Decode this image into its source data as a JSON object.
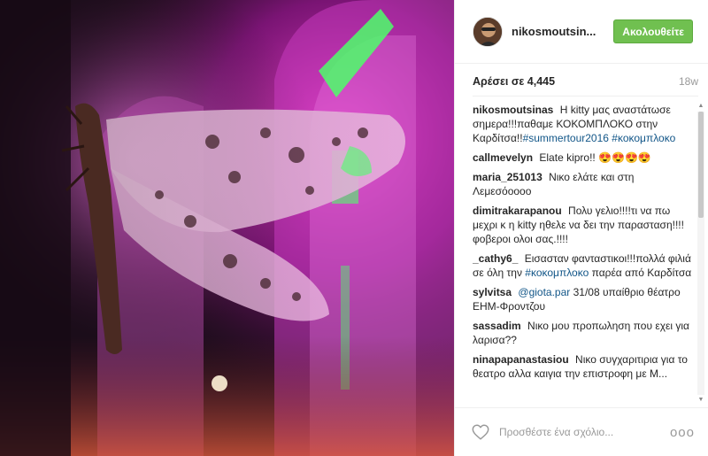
{
  "header": {
    "username": "nikosmoutsin...",
    "follow_label": "Ακολουθείτε"
  },
  "stats": {
    "likes": "Αρέσει σε 4,445",
    "time": "18w"
  },
  "caption": {
    "author": "nikosmoutsinas",
    "text": "Η kitty μας αναστάτωσε σημερα!!!παθαμε ΚΟΚΟΜΠΛΟΚΟ στην Καρδίτσα!!",
    "tags": [
      "#summertour2016",
      "#κοκομπλοκο"
    ]
  },
  "comments": [
    {
      "author": "callmevelyn",
      "text": "Elate kipro!! 😍😍😍😍"
    },
    {
      "author": "maria_251013",
      "text": "Νικο ελάτε και στη Λεμεσόοοοο"
    },
    {
      "author": "dimitrakarapanou",
      "text": "Πολυ γελιο!!!!τι να πω μεχρι κ η kitty ηθελε να δει την παρασταση!!!!φοβεροι ολοι σας.!!!!"
    },
    {
      "author": "_cathy6_",
      "text_before": "Εισασταν φανταστικοι!!!πολλά φιλιά σε όλη την ",
      "tag": "#κοκομπλοκο",
      "text_after": " παρέα από Καρδίτσα"
    },
    {
      "author": "sylvitsa",
      "mention": "@giota.par",
      "text": " 31/08 υπαίθριο θέατρο ΕΗΜ-Φροντζου"
    },
    {
      "author": "sassadim",
      "text": "Νικο μου προπωληση που εχει για λαρισα??"
    },
    {
      "author": "ninapapanastasiou",
      "text": "Νικο συγχαριτιρια για το θεατρο αλλα καιγια την επιστροφη με Μ..."
    }
  ],
  "footer": {
    "comment_placeholder": "Προσθέστε ένα σχόλιο...",
    "more_label": "ooo"
  },
  "icons": {
    "heart": "heart-icon",
    "more": "more-options-icon",
    "avatar": "avatar"
  },
  "colors": {
    "follow_button": "#70c050",
    "tag_link": "#125688",
    "photo_accent_magenta": "#d83bd0",
    "photo_accent_green": "#4cff6a"
  }
}
